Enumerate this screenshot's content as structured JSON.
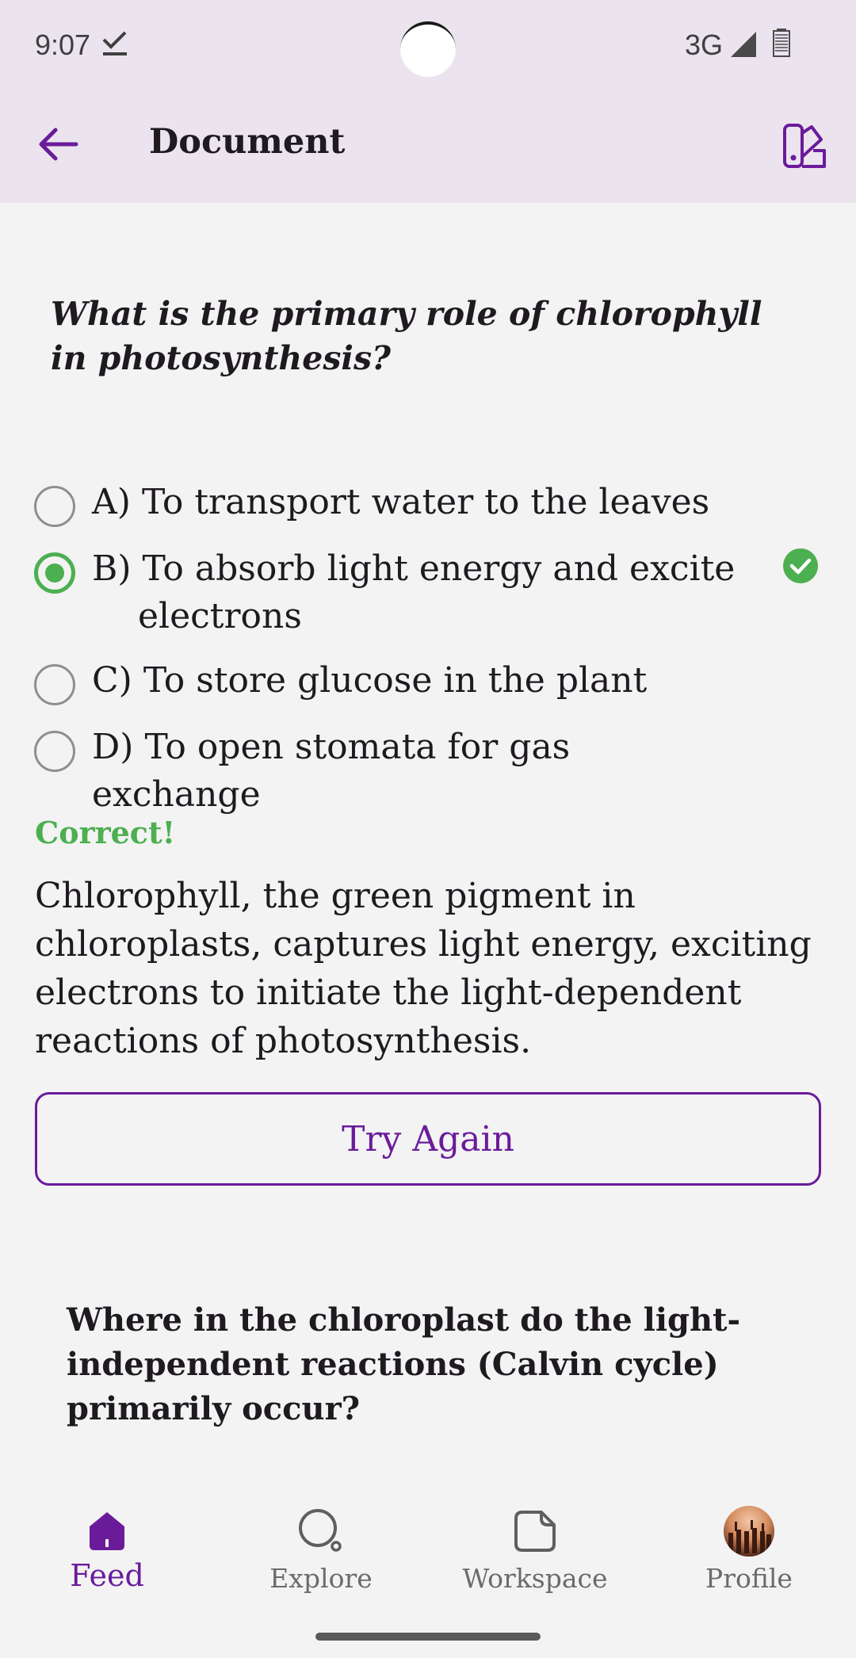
{
  "status_bar": {
    "time": "9:07",
    "network": "3G"
  },
  "app_bar": {
    "title": "Document"
  },
  "question": {
    "text": "What is the primary role of chlorophyll in photosynthesis?",
    "options": [
      {
        "letter": "A)",
        "text": "To transport water to the leaves",
        "selected": false
      },
      {
        "letter": "B)",
        "text": "To absorb light energy and excite",
        "text_cont": "electrons",
        "selected": true
      },
      {
        "letter": "C)",
        "text": "To store glucose in the plant",
        "selected": false
      },
      {
        "letter": "D)",
        "text": "To open stomata for gas exchange",
        "selected": false
      }
    ],
    "result": "Correct!",
    "explanation": "Chlorophyll, the green pigment in chloroplasts, captures light energy, exciting electrons to initiate the light-dependent reactions of photosynthesis.",
    "try_again_label": "Try Again"
  },
  "next_question": {
    "text": "Where in the chloroplast do the light-independent reactions (Calvin cycle) primarily occur?"
  },
  "bottom_nav": {
    "items": [
      {
        "label": "Feed",
        "icon": "home-icon",
        "active": true
      },
      {
        "label": "Explore",
        "icon": "search-icon",
        "active": false
      },
      {
        "label": "Workspace",
        "icon": "note-icon",
        "active": false
      },
      {
        "label": "Profile",
        "icon": "avatar",
        "active": false
      }
    ]
  },
  "colors": {
    "accent": "#6a1b9a",
    "correct": "#4caf50",
    "app_bar_bg": "#ebe4ee",
    "page_bg": "#f3f3f3"
  }
}
